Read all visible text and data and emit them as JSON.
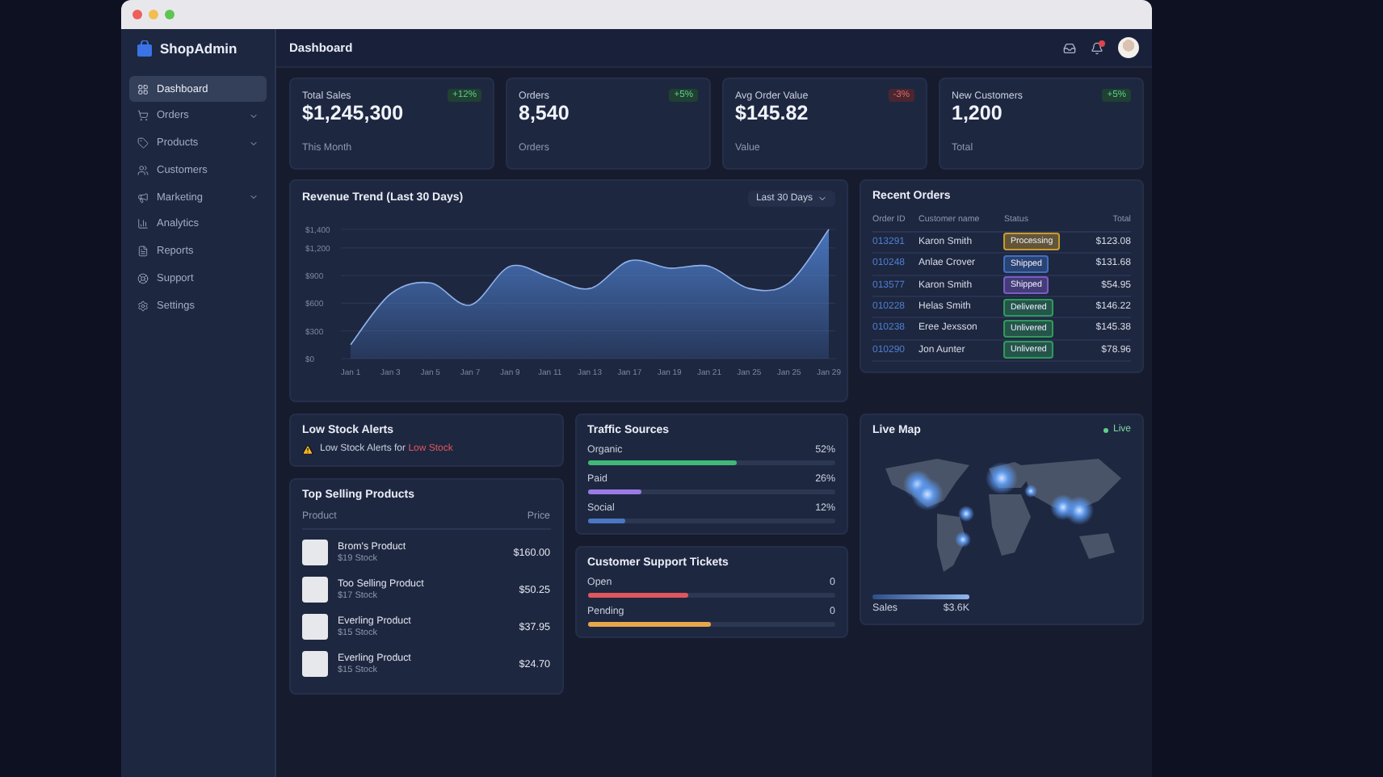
{
  "brand": {
    "name": "ShopAdmin"
  },
  "sidebar": {
    "items": [
      {
        "label": "Dashboard",
        "selected": true,
        "expandable": false
      },
      {
        "label": "Orders",
        "selected": false,
        "expandable": true
      },
      {
        "label": "Products",
        "selected": false,
        "expandable": true
      },
      {
        "label": "Customers",
        "selected": false,
        "expandable": false
      },
      {
        "label": "Marketing",
        "selected": false,
        "expandable": true
      },
      {
        "label": "Analytics",
        "selected": false,
        "expandable": false
      },
      {
        "label": "Reports",
        "selected": false,
        "expandable": false
      },
      {
        "label": "Support",
        "selected": false,
        "expandable": false
      },
      {
        "label": "Settings",
        "selected": false,
        "expandable": false
      }
    ]
  },
  "header": {
    "title": "Dashboard",
    "notifications_unread": true
  },
  "stats": [
    {
      "title": "Total Sales",
      "value": "$1,245,300",
      "subtitle": "This Month",
      "change": "+12%",
      "kind": "up"
    },
    {
      "title": "Orders",
      "value": "8,540",
      "subtitle": "Orders",
      "change": "+5%",
      "kind": "up"
    },
    {
      "title": "Avg Order Value",
      "value": "$145.82",
      "subtitle": "Value",
      "change": "-3%",
      "kind": "down"
    },
    {
      "title": "New Customers",
      "value": "1,200",
      "subtitle": "Total",
      "change": "+5%",
      "kind": "up"
    }
  ],
  "revenue": {
    "title": "Revenue Trend (Last 30 Days)",
    "range": "Last 30 Days",
    "chart_data": {
      "type": "area",
      "categories": [
        "Jan 1",
        "Jan 3",
        "Jan 5",
        "Jan 7",
        "Jan 9",
        "Jan 11",
        "Jan 13",
        "Jan 17",
        "Jan 19",
        "Jan 21",
        "Jan 25",
        "Jan 25",
        "Jan 29"
      ],
      "series": [
        {
          "color": "#4a78c2",
          "values": [
            150,
            700,
            820,
            580,
            1000,
            880,
            760,
            1060,
            980,
            1000,
            760,
            820,
            1400
          ]
        }
      ],
      "ylim": [
        0,
        1400
      ],
      "grid": true,
      "yticks": [
        {
          "value": 0,
          "label": "$0"
        },
        {
          "value": 300,
          "label": "$300"
        },
        {
          "value": 600,
          "label": "$600"
        },
        {
          "value": 900,
          "label": "$900"
        },
        {
          "value": 1200,
          "label": "$1,200"
        },
        {
          "value": 1400,
          "label": "$1,400"
        }
      ]
    }
  },
  "recent_orders": {
    "title": "Recent Orders",
    "columns": [
      "Order ID",
      "Customer name",
      "Status",
      "Total"
    ],
    "rows": [
      {
        "id": "013291",
        "customer": "Karon Smith",
        "status": "Processing",
        "color": "#c99a2e",
        "total": "$123.08"
      },
      {
        "id": "010248",
        "customer": "Anlae Crover",
        "status": "Shipped",
        "color": "#3f6fc0",
        "total": "$131.68"
      },
      {
        "id": "013577",
        "customer": "Karon Smith",
        "status": "Shipped",
        "color": "#7b5cc8",
        "total": "$54.95"
      },
      {
        "id": "010228",
        "customer": "Helas Smith",
        "status": "Delivered",
        "color": "#2f9a5a",
        "total": "$146.22"
      },
      {
        "id": "010238",
        "customer": "Eree Jexsson",
        "status": "Unlivered",
        "color": "#2f9a5a",
        "total": "$145.38"
      },
      {
        "id": "010290",
        "customer": "Jon Aunter",
        "status": "Unlivered",
        "color": "#2f9a5a",
        "total": "$78.96"
      }
    ]
  },
  "low_stock": {
    "title": "Low Stock Alerts",
    "text": "Low Stock Alerts for",
    "highlight": "Low Stock"
  },
  "top_products": {
    "title": "Top Selling Products",
    "columns": [
      "Product",
      "Price"
    ],
    "rows": [
      {
        "name": "Brom's Product",
        "stock": "$19 Stock",
        "price": "$160.00"
      },
      {
        "name": "Too Selling Product",
        "stock": "$17 Stock",
        "price": "$50.25"
      },
      {
        "name": "Everling Product",
        "stock": "$15 Stock",
        "price": "$37.95"
      },
      {
        "name": "Everling Product",
        "stock": "$15 Stock",
        "price": "$24.70"
      }
    ]
  },
  "traffic": {
    "title": "Traffic Sources",
    "sources": [
      {
        "label": "Organic",
        "value": "52%",
        "level": 0.6,
        "color": "#3fb878"
      },
      {
        "label": "Paid",
        "value": "26%",
        "level": 0.22,
        "color": "#9a7be6"
      },
      {
        "label": "Social",
        "value": "12%",
        "level": 0.15,
        "color": "#4a78c2"
      }
    ]
  },
  "tickets": {
    "title": "Customer Support Tickets",
    "items": [
      {
        "label": "Open",
        "value": "0",
        "level": 0.41,
        "color": "#e0565e"
      },
      {
        "label": "Pending",
        "value": "0",
        "level": 0.5,
        "color": "#e8a84a"
      }
    ]
  },
  "live_map": {
    "title": "Live Map",
    "status": "Live",
    "legend_label": "Sales",
    "legend_value": "$3.6K"
  }
}
